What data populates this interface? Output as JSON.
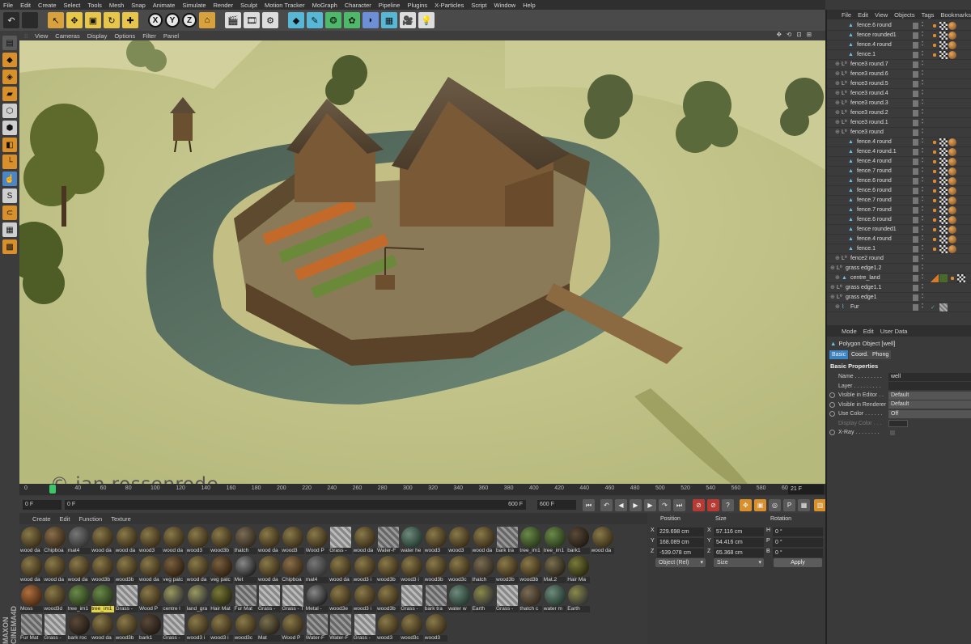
{
  "menubar": [
    "File",
    "Edit",
    "Create",
    "Select",
    "Tools",
    "Mesh",
    "Snap",
    "Animate",
    "Simulate",
    "Render",
    "Sculpt",
    "Motion Tracker",
    "MoGraph",
    "Character",
    "Pipeline",
    "Plugins",
    "X-Particles",
    "Script",
    "Window",
    "Help"
  ],
  "viewport": {
    "menu": [
      "View",
      "Cameras",
      "Display",
      "Options",
      "Filter",
      "Panel"
    ],
    "nav_icons": "✥ ⟲ ⊡ ⊞",
    "watermark": "© ian rossenrode"
  },
  "timeline": {
    "ticks": [
      "0",
      "20",
      "40",
      "60",
      "80",
      "100",
      "120",
      "140",
      "160",
      "180",
      "200",
      "220",
      "240",
      "260",
      "280",
      "300",
      "320",
      "340",
      "360",
      "380",
      "400",
      "420",
      "440",
      "460",
      "480",
      "500",
      "520",
      "540",
      "560",
      "580",
      "600"
    ],
    "current_frame_marker": "21",
    "frame_display": "21 F",
    "current_frame_fraction": 0.035
  },
  "transport": {
    "start_field": "0 F",
    "preview_start": "0 F",
    "preview_end": "600 F",
    "end_field": "600 F"
  },
  "materials": {
    "menu": [
      "Create",
      "Edit",
      "Function",
      "Texture"
    ],
    "rows": [
      [
        "wood da",
        "Chipboa",
        "mat4",
        "wood da",
        "wood da",
        "wood3",
        "wood da",
        "wood3",
        "wood3b",
        "thatch",
        "wood da",
        "wood3",
        "Wood P",
        "Grass -",
        "wood da",
        "Water-F",
        "water he",
        "wood3",
        "wood3",
        "wood da",
        "bark tra",
        "tree_im1",
        "tree_im1",
        "bark1",
        "wood da"
      ],
      [
        "wood da",
        "wood da",
        "wood da",
        "wood3b",
        "wood3b",
        "wood da",
        "veg patc",
        "wood da",
        "veg patc",
        "Met",
        "wood da",
        "Chipboa",
        "mat4",
        "wood da",
        "wood3 i",
        "wood3b",
        "wood3 i",
        "wood3b",
        "wood3c",
        "thatch",
        "wood3b",
        "wood3b",
        "Mat.2",
        "Hair Ma"
      ],
      [
        "Moss",
        "wood3d",
        "tree_im1",
        "tree_im1",
        "Grass -",
        "Wood P",
        "centre l",
        "land_gra",
        "Hair Mat",
        "Fur Mat",
        "Grass -",
        "Grass - T",
        "Metal -",
        "wood3e",
        "wood3 i",
        "wood3b",
        "Grass -",
        "bark tra",
        "water w",
        "Earth",
        "Grass -",
        "thatch c",
        "water m",
        "Earth"
      ],
      [
        "Fur Mat",
        "Grass -",
        "bark roc",
        "wood da",
        "wood3b",
        "bark1",
        "Grass -",
        "wood3 i",
        "wood3 i",
        "wood3c",
        "Mat",
        "Wood P",
        "Water-F",
        "Water-F",
        "Grass -",
        "wood3",
        "wood3c",
        "wood3"
      ]
    ],
    "selected": "tree_im1"
  },
  "brand": "MAXON CINEMA4D",
  "coordinates": {
    "headers": [
      "Position",
      "Size",
      "Rotation"
    ],
    "rows": [
      {
        "axis": "X",
        "pos": "229.698 cm",
        "size_axis": "X",
        "size": "57.116 cm",
        "rot_axis": "H",
        "rot": "0 °"
      },
      {
        "axis": "Y",
        "pos": "168.089 cm",
        "size_axis": "Y",
        "size": "54.416 cm",
        "rot_axis": "P",
        "rot": "0 °"
      },
      {
        "axis": "Z",
        "pos": "-539.078 cm",
        "size_axis": "Z",
        "size": "65.368 cm",
        "rot_axis": "B",
        "rot": "0 °"
      }
    ],
    "mode_dropdown": "Object (Rel)",
    "size_dropdown": "Size",
    "apply_label": "Apply"
  },
  "objects": {
    "menu": [
      "File",
      "Edit",
      "View",
      "Objects",
      "Tags",
      "Bookmarks"
    ],
    "items": [
      {
        "name": "fence.6 round",
        "indent": 2,
        "tags": "bcd"
      },
      {
        "name": "fence rounded1",
        "indent": 2,
        "tags": "bcd"
      },
      {
        "name": "fence.4 round",
        "indent": 2,
        "tags": "bcd"
      },
      {
        "name": "fence.1",
        "indent": 2,
        "tags": "bcd"
      },
      {
        "name": "fence3 round.7",
        "indent": 1,
        "tags": ""
      },
      {
        "name": "fence3 round.6",
        "indent": 1,
        "tags": ""
      },
      {
        "name": "fence3 round.5",
        "indent": 1,
        "tags": ""
      },
      {
        "name": "fence3 round.4",
        "indent": 1,
        "tags": ""
      },
      {
        "name": "fence3 round.3",
        "indent": 1,
        "tags": ""
      },
      {
        "name": "fence3 round.2",
        "indent": 1,
        "tags": ""
      },
      {
        "name": "fence3 round.1",
        "indent": 1,
        "tags": ""
      },
      {
        "name": "fence3 round",
        "indent": 1,
        "tags": ""
      },
      {
        "name": "fence.4 round",
        "indent": 2,
        "tags": "bcd"
      },
      {
        "name": "fence.4 round.1",
        "indent": 2,
        "tags": "bcd"
      },
      {
        "name": "fence.4 round",
        "indent": 2,
        "tags": "bcd"
      },
      {
        "name": "fence.7 round",
        "indent": 2,
        "tags": "bcd"
      },
      {
        "name": "fence.6 round",
        "indent": 2,
        "tags": "bcd"
      },
      {
        "name": "fence.6 round",
        "indent": 2,
        "tags": "bcd"
      },
      {
        "name": "fence.7 round",
        "indent": 2,
        "tags": "bcd"
      },
      {
        "name": "fence.7 round",
        "indent": 2,
        "tags": "bcd"
      },
      {
        "name": "fence.6 round",
        "indent": 2,
        "tags": "bcd"
      },
      {
        "name": "fence rounded1",
        "indent": 2,
        "tags": "bcd"
      },
      {
        "name": "fence.4 round",
        "indent": 2,
        "tags": "bcd"
      },
      {
        "name": "fence.1",
        "indent": 2,
        "tags": "bcd"
      },
      {
        "name": "fence2 round",
        "indent": 1,
        "tags": ""
      },
      {
        "name": "grass edge1.2",
        "indent": 0,
        "tags": ""
      },
      {
        "name": "centre_land",
        "indent": 1,
        "tags": "tgd"
      },
      {
        "name": "grass edge1.1",
        "indent": 0,
        "tags": ""
      },
      {
        "name": "grass edge1",
        "indent": 0,
        "tags": ""
      },
      {
        "name": "Fur",
        "indent": 1,
        "tags": "f"
      }
    ]
  },
  "attributes": {
    "menu": [
      "Mode",
      "Edit",
      "User Data"
    ],
    "title": "Polygon Object [well]",
    "tabs": [
      "Basic",
      "Coord.",
      "Phong"
    ],
    "section": "Basic Properties",
    "fields": [
      {
        "label": "Name . . . . . . . . .",
        "value": "well",
        "radio": false,
        "dropdown": false
      },
      {
        "label": "Layer . . . . . . . . .",
        "value": "",
        "radio": false,
        "dropdown": false
      },
      {
        "label": "Visible in Editor . .",
        "value": "Default",
        "radio": true,
        "dropdown": true
      },
      {
        "label": "Visible in Renderer",
        "value": "Default",
        "radio": true,
        "dropdown": true
      },
      {
        "label": "Use Color . . . . . .",
        "value": "Off",
        "radio": true,
        "dropdown": true
      },
      {
        "label": "Display Color . . .",
        "value": "",
        "radio": false,
        "dropdown": false
      },
      {
        "label": "X-Ray . . . . . . . .",
        "value": "",
        "radio": true,
        "dropdown": false
      }
    ]
  },
  "colors": {
    "accent": "#3b84c4",
    "playhead": "#3ac765",
    "tool_orange": "#d9a13b"
  }
}
